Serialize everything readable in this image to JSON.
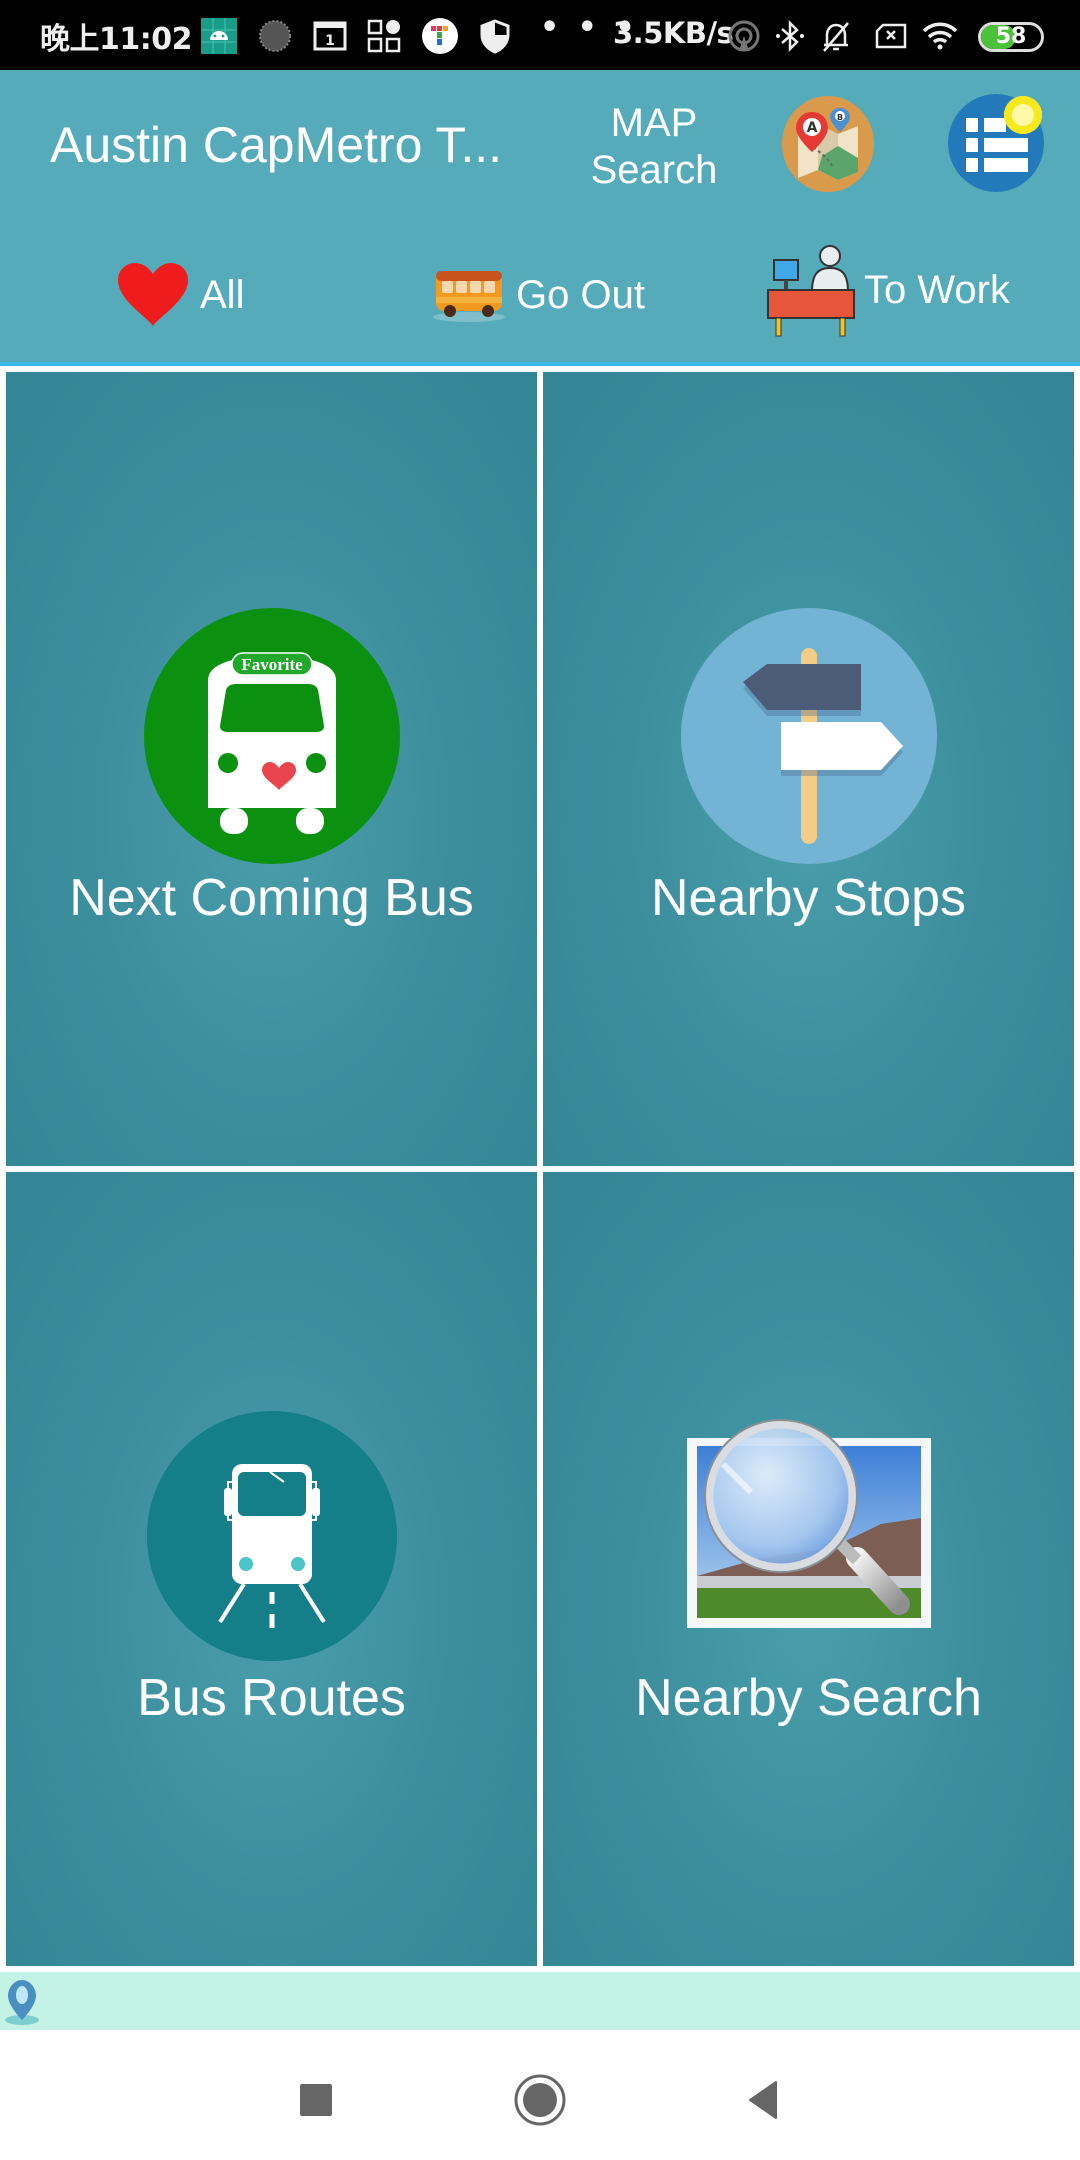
{
  "status_bar": {
    "time": "晚上11:02",
    "net_speed": "3.5KB/s",
    "dots": "• • •",
    "battery_level": "58",
    "battery_fraction": 0.58,
    "icons": [
      "android-debug-icon",
      "loading-icon",
      "calendar-icon",
      "apps-icon",
      "app-t-icon",
      "shield-icon",
      "hotspot-icon",
      "bluetooth-icon",
      "mute-bell-icon",
      "no-sim-icon",
      "wifi-icon",
      "battery-icon"
    ],
    "calendar_day": "1"
  },
  "header": {
    "title": "Austin CapMetro T...",
    "map_search_line1": "MAP",
    "map_search_line2": "Search",
    "map_icon": "map-route-a-b-icon",
    "menu_icon": "menu-list-icon",
    "accent_color": "#56abbb",
    "tab_underline_color": "#3cb8e6"
  },
  "tabs": [
    {
      "label": "All",
      "icon": "heart-icon"
    },
    {
      "label": "Go Out",
      "icon": "bus-icon"
    },
    {
      "label": "To Work",
      "icon": "desk-worker-icon"
    }
  ],
  "tiles": [
    {
      "label": "Next Coming Bus",
      "icon": "favorite-bus-icon",
      "badge": "Favorite"
    },
    {
      "label": "Nearby Stops",
      "icon": "signpost-icon"
    },
    {
      "label": "Bus Routes",
      "icon": "bus-route-icon"
    },
    {
      "label": "Nearby Search",
      "icon": "magnifier-photo-icon"
    }
  ],
  "ad_strip": {
    "icon": "location-pin-icon"
  },
  "navbar": {
    "buttons": [
      "recents",
      "home",
      "back"
    ]
  }
}
